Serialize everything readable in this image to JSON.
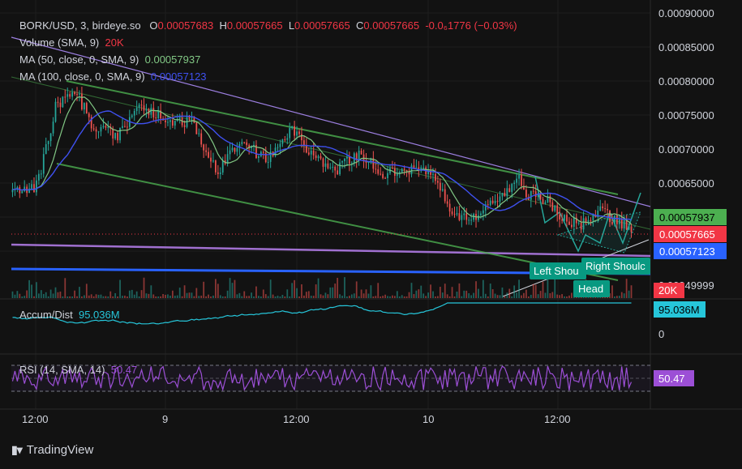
{
  "header": {
    "symbol": "BORK/USD, 3, birdeye.so",
    "o_label": "O",
    "o_value": "0.00057683",
    "h_label": "H",
    "h_value": "0.00057665",
    "l_label": "L",
    "l_value": "0.00057665",
    "c_label": "C",
    "c_value": "0.00057665",
    "change": "-0.0₆1776 (−0.03%)"
  },
  "indicators": {
    "volume_label": "Volume (SMA, 9)",
    "volume_value": "20K",
    "ma50_label": "MA (50, close, 0, SMA, 9)",
    "ma50_value": "0.00057937",
    "ma100_label": "MA (100, close, 0, SMA, 9)",
    "ma100_value": "0.00057123",
    "accum_label": "Accum/Dist",
    "accum_value": "95.036M",
    "rsi_label": "RSI (14, SMA, 14)",
    "rsi_value": "50.47"
  },
  "price_axis": [
    "0.00090000",
    "0.00085000",
    "0.00080000",
    "0.00075000",
    "0.00070000",
    "0.00065000",
    "0.00049999"
  ],
  "price_tags": {
    "ma50": "0.00057937",
    "close": "0.00057665",
    "ma100": "0.00057123",
    "volume": "20K",
    "accum": "95.036M",
    "accum_zero": "0",
    "rsi": "50.47"
  },
  "time_axis": [
    "12:00",
    "9",
    "12:00",
    "10",
    "12:00"
  ],
  "pattern_labels": {
    "left": "Left Shou",
    "right": "Right Shoulc",
    "head": "Head"
  },
  "colors": {
    "background": "#121212",
    "up": "#26a69a",
    "down": "#ef5350",
    "ma50": "#81c784",
    "ma100": "#3f51f0",
    "channel": "#4caf50",
    "trend": "#9c7fe0",
    "support": "#a070d0",
    "blue_line": "#2962ff",
    "accum": "#26c6da",
    "rsi": "#9c4fd6",
    "tag_green": "#4caf50",
    "tag_red": "#f23645",
    "tag_blue": "#2962ff",
    "tag_teal": "#26c6da",
    "tag_purple": "#9c4fd6",
    "label_teal": "#089981"
  },
  "footer": {
    "brand": "TradingView"
  },
  "chart_data": {
    "type": "candlestick",
    "title": "BORK/USD, 3, birdeye.so",
    "y_range": [
      0.00049,
      0.0009
    ],
    "x_ticks": [
      "12:00",
      "9",
      "12:00",
      "10",
      "12:00"
    ],
    "overlays": [
      "MA (50, close, 0, SMA, 9)",
      "MA (100, close, 0, SMA, 9)",
      "Volume (SMA, 9)"
    ],
    "price_anchors": [
      {
        "t": 0.0,
        "p": 0.00063
      },
      {
        "t": 0.04,
        "p": 0.00064
      },
      {
        "t": 0.07,
        "p": 0.00076
      },
      {
        "t": 0.1,
        "p": 0.000785
      },
      {
        "t": 0.13,
        "p": 0.00073
      },
      {
        "t": 0.17,
        "p": 0.000715
      },
      {
        "t": 0.21,
        "p": 0.00076
      },
      {
        "t": 0.25,
        "p": 0.00074
      },
      {
        "t": 0.29,
        "p": 0.000735
      },
      {
        "t": 0.33,
        "p": 0.00066
      },
      {
        "t": 0.37,
        "p": 0.000705
      },
      {
        "t": 0.41,
        "p": 0.00068
      },
      {
        "t": 0.45,
        "p": 0.000725
      },
      {
        "t": 0.48,
        "p": 0.00069
      },
      {
        "t": 0.52,
        "p": 0.00066
      },
      {
        "t": 0.56,
        "p": 0.00069
      },
      {
        "t": 0.6,
        "p": 0.000655
      },
      {
        "t": 0.64,
        "p": 0.000665
      },
      {
        "t": 0.68,
        "p": 0.000655
      },
      {
        "t": 0.71,
        "p": 0.0006
      },
      {
        "t": 0.74,
        "p": 0.00059
      },
      {
        "t": 0.78,
        "p": 0.00062
      },
      {
        "t": 0.82,
        "p": 0.00065
      },
      {
        "t": 0.83,
        "p": 0.000625
      },
      {
        "t": 0.86,
        "p": 0.00062
      },
      {
        "t": 0.89,
        "p": 0.00059
      },
      {
        "t": 0.92,
        "p": 0.00058
      },
      {
        "t": 0.95,
        "p": 0.0006
      },
      {
        "t": 0.98,
        "p": 0.000585
      },
      {
        "t": 1.0,
        "p": 0.000577
      }
    ],
    "ma50_last": 0.00057937,
    "ma100_last": 0.00057123,
    "last_close": 0.00057665,
    "accum_dist_last": "95.036M",
    "rsi_last": 50.47,
    "rsi_bands": [
      30,
      70
    ]
  }
}
